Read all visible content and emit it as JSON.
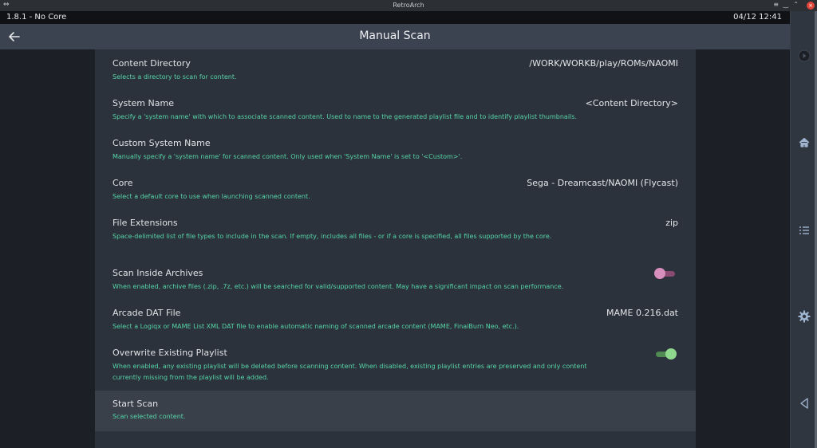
{
  "window": {
    "title": "RetroArch",
    "version_core": "1.8.1 - No Core",
    "datetime": "04/12 12:41"
  },
  "header": {
    "title": "Manual Scan"
  },
  "items": [
    {
      "label": "Content Directory",
      "value": "/WORK/WORKB/play/ROMs/NAOMI",
      "desc": "Selects a directory to scan for content."
    },
    {
      "label": "System Name",
      "value": "<Content Directory>",
      "desc": "Specify a 'system name' with which to associate scanned content. Used to name to the generated playlist file and to identify playlist thumbnails."
    },
    {
      "label": "Custom System Name",
      "value": "",
      "desc": "Manually specify a 'system name' for scanned content. Only used when 'System Name' is set to '<Custom>'."
    },
    {
      "label": "Core",
      "value": "Sega - Dreamcast/NAOMI (Flycast)",
      "desc": "Select a default core to use when launching scanned content."
    },
    {
      "label": "File Extensions",
      "value": "zip",
      "desc": "Space-delimited list of file types to include in the scan. If empty, includes all files - or if a core is specified, all files supported by the core."
    },
    {
      "label": "Scan Inside Archives",
      "toggle": false,
      "desc": "When enabled, archive files (.zip, .7z, etc.) will be searched for valid/supported content. May have a significant impact on scan performance."
    },
    {
      "label": "Arcade DAT File",
      "value": "MAME 0.216.dat",
      "desc": "Select a Logiqx or MAME List XML DAT file to enable automatic naming of scanned arcade content (MAME, FinalBurn Neo, etc.)."
    },
    {
      "label": "Overwrite Existing Playlist",
      "toggle": true,
      "desc": "When enabled, any existing playlist will be deleted before scanning content. When disabled, existing playlist entries are preserved and only content currently missing from the playlist will be added."
    },
    {
      "label": "Start Scan",
      "desc": "Scan selected content."
    }
  ],
  "sidebar": {
    "icons": [
      "play-icon",
      "home-icon",
      "list-icon",
      "gear-icon",
      "triangle-back-icon"
    ]
  },
  "colors": {
    "desc_text": "#56d4a8",
    "toggle_off_knob": "#d88fbd",
    "toggle_on_knob": "#8fd98f",
    "header_bg": "#3b4350",
    "content_bg": "#2c323b"
  }
}
